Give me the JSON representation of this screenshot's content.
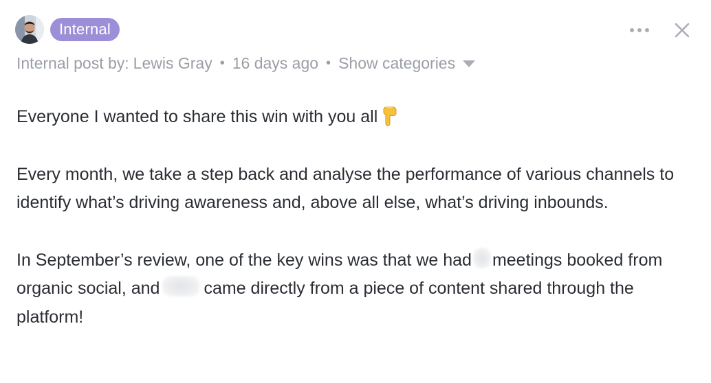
{
  "header": {
    "badge_label": "Internal"
  },
  "meta": {
    "prefix": "Internal post by: ",
    "author": "Lewis Gray",
    "separator": "•",
    "time_ago": "16 days ago",
    "show_categories_label": "Show categories"
  },
  "actions": {
    "more_icon": "more-horizontal-icon",
    "close_icon": "close-icon"
  },
  "body": {
    "p1_mention": "Everyone",
    "p1_text": " I wanted to share this win with you all",
    "p1_emoji": "pointing-down-emoji",
    "p2_text": "Every month, we take a step back and analyse the performance of various channels to identify what’s driving awareness and, above all else, what’s driving inbounds.",
    "p3_part1": "In September’s review, one of the key wins was that we had",
    "p3_part2": "meetings booked from organic social, and",
    "p3_part3": "came directly from a piece of content shared through the platform!"
  },
  "colors": {
    "badge_bg": "#9c8fd8",
    "meta_text": "#9a9ea6",
    "body_text": "#2a2d33",
    "icon_grey": "#a9adb6"
  }
}
